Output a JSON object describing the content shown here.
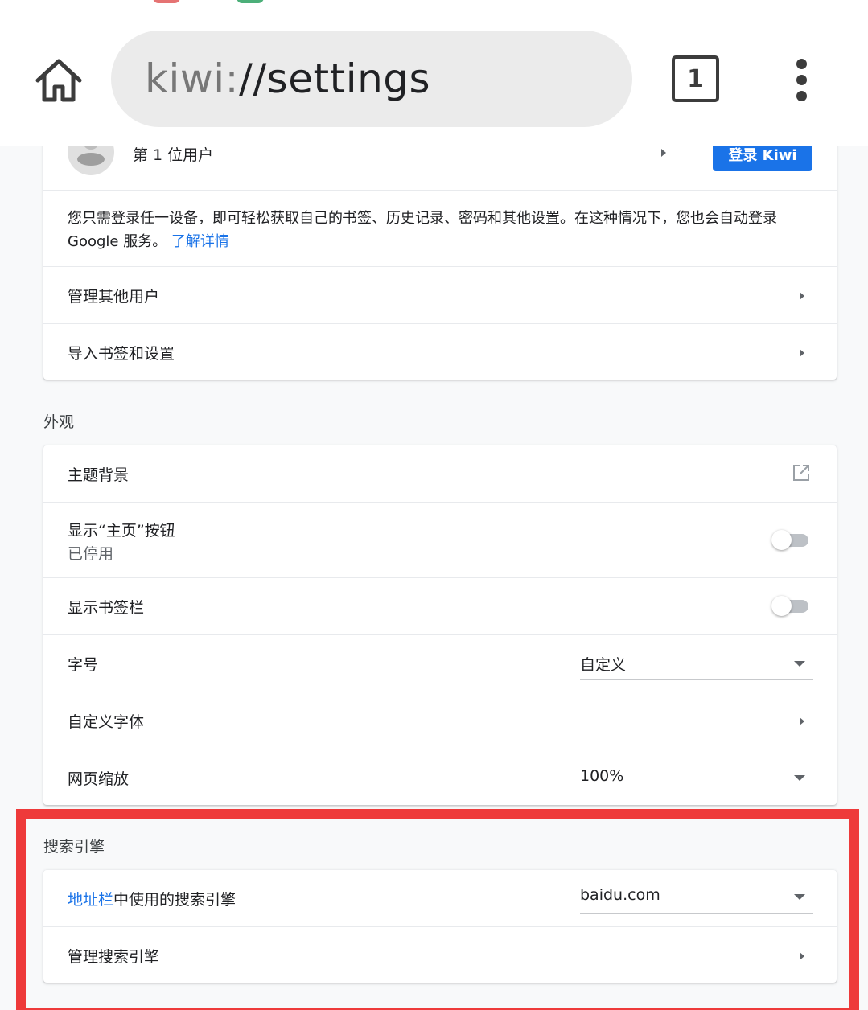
{
  "browser": {
    "url_scheme": "kiwi:",
    "url_host": "//settings",
    "tab_count": "1",
    "icons": {
      "home": "home-icon",
      "menu": "more-vert-icon"
    }
  },
  "account": {
    "user_name": "第 1 位用户",
    "signin_label": "登录 Kiwi",
    "description": "您只需登录任一设备，即可轻松获取自己的书签、历史记录、密码和其他设置。在这种情况下，您也会自动登录",
    "description_line2": "Google 服务。",
    "learn_more": "了解详情",
    "manage_users": "管理其他用户",
    "import": "导入书签和设置"
  },
  "appearance": {
    "title": "外观",
    "theme": "主题背景",
    "show_home": "显示“主页”按钮",
    "show_home_status": "已停用",
    "bookmarks_bar": "显示书签栏",
    "font_size_label": "字号",
    "font_size_value": "自定义",
    "custom_fonts": "自定义字体",
    "zoom_label": "网页缩放",
    "zoom_value": "100%"
  },
  "search": {
    "title": "搜索引擎",
    "engine_label_link": "地址栏",
    "engine_label_rest": "中使用的搜索引擎",
    "engine_value": "baidu.com",
    "manage": "管理搜索引擎"
  },
  "colors": {
    "accent": "#1a73e8",
    "highlight": "#ee3a3a"
  }
}
